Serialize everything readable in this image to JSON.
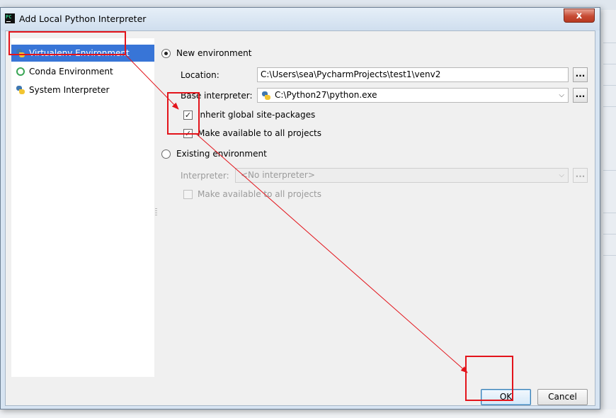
{
  "window": {
    "title": "Add Local Python Interpreter",
    "close_symbol": "x"
  },
  "sidebar": {
    "items": [
      {
        "label": "Virtualenv Environment",
        "icon": "python-icon",
        "selected": true
      },
      {
        "label": "Conda Environment",
        "icon": "conda-icon",
        "selected": false
      },
      {
        "label": "System Interpreter",
        "icon": "python-icon",
        "selected": false
      }
    ]
  },
  "new_env": {
    "radio_label": "New environment",
    "selected": true,
    "location_label": "Location:",
    "location_value": "C:\\Users\\sea\\PycharmProjects\\test1\\venv2",
    "base_label": "Base interpreter:",
    "base_value": "C:\\Python27\\python.exe",
    "browse_label": "...",
    "inherit_label": "Inherit global site-packages",
    "inherit_checked": true,
    "make_available_label": "Make available to all projects",
    "make_available_checked": true
  },
  "existing_env": {
    "radio_label": "Existing environment",
    "selected": false,
    "interpreter_label": "Interpreter:",
    "interpreter_value": "<No interpreter>",
    "browse_label": "...",
    "make_available_label": "Make available to all projects",
    "make_available_checked": false
  },
  "buttons": {
    "ok_label": "OK",
    "cancel_label": "Cancel"
  },
  "glyphs": {
    "check": "✓",
    "dropdown_arrow": "⌵"
  },
  "colors": {
    "selection": "#3875d7",
    "annotation": "#e3141b",
    "default_button_border": "#3c7fb1"
  }
}
